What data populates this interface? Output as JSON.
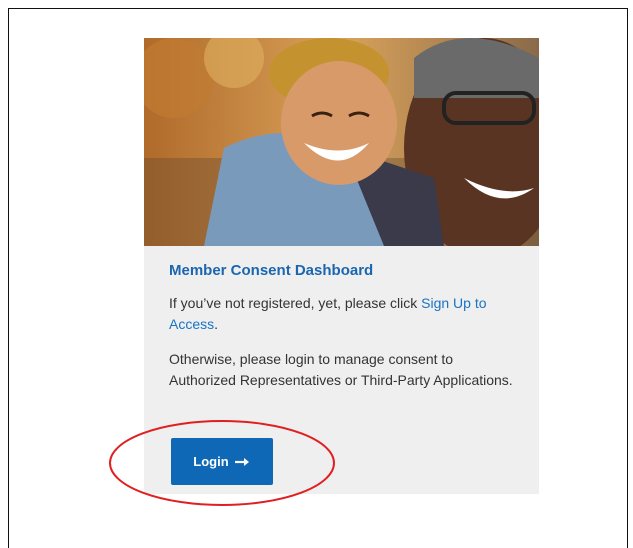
{
  "card": {
    "title": "Member Consent Dashboard",
    "intro_text": "If you’ve not registered, yet, please click ",
    "signup_link": "Sign Up to Access",
    "intro_end": ".",
    "login_text": "Otherwise, please login to manage consent to Authorized Representatives or Third-Party Applications.",
    "login_button": "Login",
    "hero_image": "photo of smiling child hugging man"
  },
  "colors": {
    "accent": "#0f68b6",
    "title": "#1a66b0",
    "annotation": "#e02020"
  },
  "icons": {
    "login_arrow": "arrow-right-icon"
  }
}
